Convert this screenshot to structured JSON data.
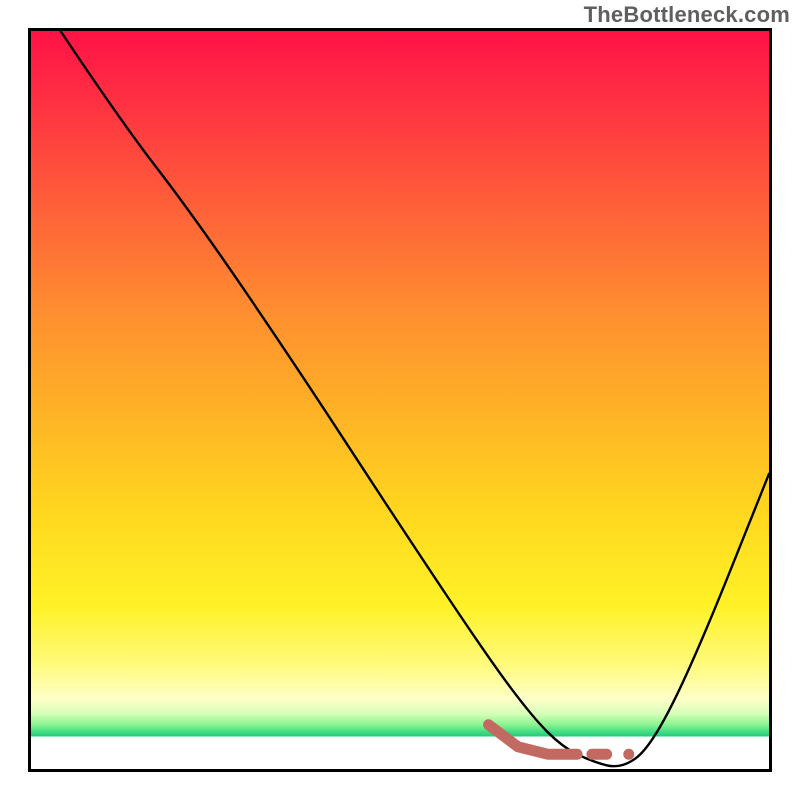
{
  "watermark": "TheBottleneck.com",
  "colors": {
    "curve": "#000000",
    "accent": "#c26a62",
    "border": "#000000"
  },
  "chart_data": {
    "type": "line",
    "title": "",
    "xlabel": "",
    "ylabel": "",
    "xlim": [
      0,
      100
    ],
    "ylim": [
      0,
      100
    ],
    "grid": false,
    "legend": false,
    "series": [
      {
        "name": "bottleneck_curve",
        "x": [
          4,
          12,
          22,
          35,
          50,
          62,
          68,
          72,
          76,
          80,
          84,
          90,
          100
        ],
        "y": [
          100,
          88,
          75,
          56,
          33,
          15,
          7,
          3,
          1,
          0,
          3,
          15,
          40
        ]
      },
      {
        "name": "accent_segment",
        "x": [
          62,
          66,
          70,
          74
        ],
        "y": [
          6,
          3,
          2,
          2
        ]
      },
      {
        "name": "accent_dash",
        "x": [
          76,
          78
        ],
        "y": [
          2,
          2
        ]
      },
      {
        "name": "accent_dot",
        "x": [
          81
        ],
        "y": [
          2
        ]
      }
    ]
  }
}
